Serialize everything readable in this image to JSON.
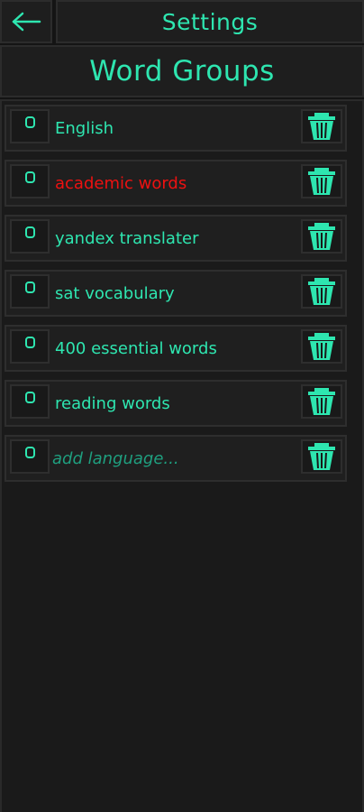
{
  "header": {
    "back_icon": "arrow-left-icon",
    "settings_label": "Settings"
  },
  "page": {
    "title": "Word Groups"
  },
  "colors": {
    "accent": "#2ee6b0",
    "highlight": "#ee1111",
    "placeholder": "#1f9f7f",
    "background": "#141414"
  },
  "groups": [
    {
      "label": "English"
    },
    {
      "label": "academic words"
    },
    {
      "label": "yandex translater"
    },
    {
      "label": "sat vocabulary"
    },
    {
      "label": "400 essential words"
    },
    {
      "label": "reading words"
    }
  ],
  "add_row": {
    "placeholder": "add language..."
  }
}
